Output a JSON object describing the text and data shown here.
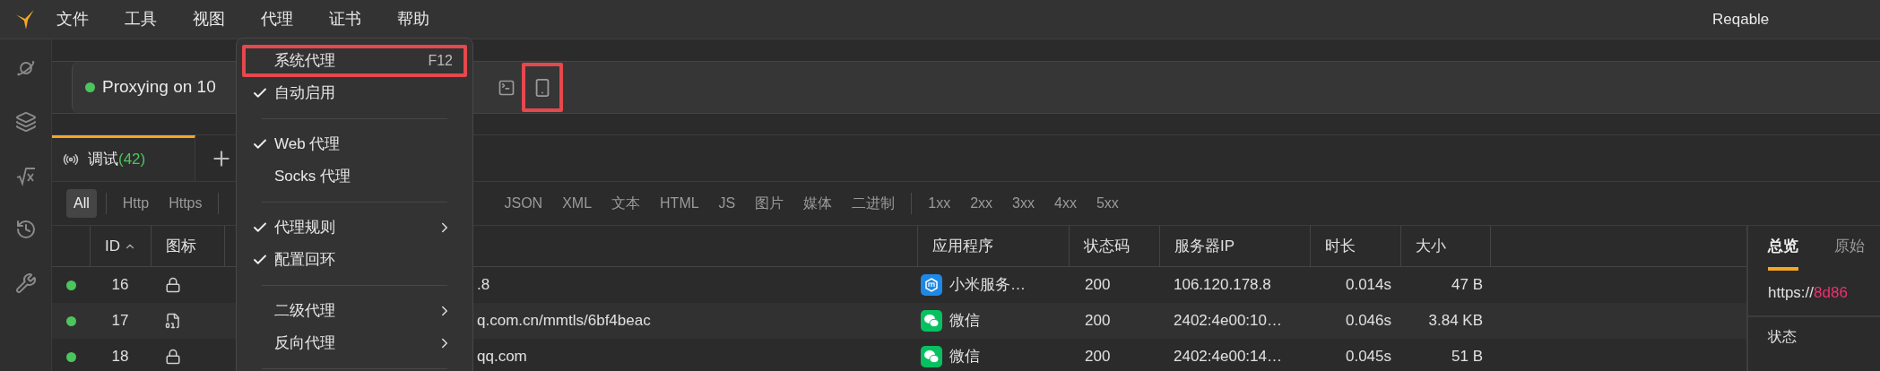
{
  "app": {
    "name": "Reqable"
  },
  "menubar": [
    "文件",
    "工具",
    "视图",
    "代理",
    "证书",
    "帮助"
  ],
  "proxy_bar": {
    "running": true,
    "status": "Proxying on 10",
    "actions": [
      {
        "kind": "terminal",
        "annotated": false
      },
      {
        "kind": "phone",
        "annotated": true
      }
    ]
  },
  "tabs": [
    {
      "label": "调试",
      "count": "(42)",
      "selected": true
    }
  ],
  "filters": [
    [
      {
        "label": "All",
        "selected": true
      }
    ],
    [
      {
        "label": "Http",
        "selected": false
      },
      {
        "label": "Https",
        "selected": false
      }
    ],
    [
      {
        "label": "JSON",
        "selected": false
      },
      {
        "label": "XML",
        "selected": false
      },
      {
        "label": "文本",
        "selected": false
      },
      {
        "label": "HTML",
        "selected": false
      },
      {
        "label": "JS",
        "selected": false
      },
      {
        "label": "图片",
        "selected": false
      },
      {
        "label": "媒体",
        "selected": false
      },
      {
        "label": "二进制",
        "selected": false
      }
    ],
    [
      {
        "label": "1xx",
        "selected": false
      },
      {
        "label": "2xx",
        "selected": false
      },
      {
        "label": "3xx",
        "selected": false
      },
      {
        "label": "4xx",
        "selected": false
      },
      {
        "label": "5xx",
        "selected": false
      }
    ]
  ],
  "table": {
    "columns": [
      {
        "label": "ID",
        "sorted": true
      },
      {
        "label": "图标",
        "sorted": false
      },
      {
        "label": "应用程序",
        "sorted": false
      },
      {
        "label": "状态码",
        "sorted": false
      },
      {
        "label": "服务器IP",
        "sorted": false
      },
      {
        "label": "时长",
        "sorted": false
      },
      {
        "label": "大小",
        "sorted": false
      }
    ],
    "rows": [
      {
        "id": "16",
        "icon": {
          "kind": "lock"
        },
        "url": ".8",
        "app": {
          "kind": "mi",
          "name": "小米服务…"
        },
        "status": "200",
        "ip": "106.120.178.8",
        "duration": "0.014s",
        "size": "47 B"
      },
      {
        "id": "17",
        "icon": {
          "kind": "binary"
        },
        "url": "q.com.cn/mmtls/6bf4beac",
        "app": {
          "kind": "wechat",
          "name": "微信"
        },
        "status": "200",
        "ip": "2402:4e00:10…",
        "duration": "0.046s",
        "size": "3.84 KB"
      },
      {
        "id": "18",
        "icon": {
          "kind": "lock"
        },
        "url": "qq.com",
        "app": {
          "kind": "wechat",
          "name": "微信"
        },
        "status": "200",
        "ip": "2402:4e00:14…",
        "duration": "0.045s",
        "size": "51 B"
      }
    ]
  },
  "detail": {
    "tabs": [
      {
        "label": "总览",
        "selected": true
      },
      {
        "label": "原始",
        "selected": false
      }
    ],
    "url_scheme": "https://",
    "url_host": "8d86",
    "fields": [
      "状态"
    ]
  },
  "menu": {
    "groups": [
      [
        {
          "label": "系统代理",
          "shortcut": "F12",
          "checked": false,
          "submenu": false,
          "annotated": true
        },
        {
          "label": "自动启用",
          "checked": true,
          "submenu": false,
          "annotated": false
        }
      ],
      [
        {
          "label": "Web 代理",
          "checked": true,
          "submenu": false,
          "annotated": false
        },
        {
          "label": "Socks 代理",
          "checked": false,
          "submenu": false,
          "annotated": false
        }
      ],
      [
        {
          "label": "代理规则",
          "checked": true,
          "submenu": true,
          "annotated": false
        },
        {
          "label": "配置回环",
          "checked": true,
          "submenu": false,
          "annotated": false
        }
      ],
      [
        {
          "label": "二级代理",
          "checked": false,
          "submenu": true,
          "annotated": false
        },
        {
          "label": "反向代理",
          "checked": false,
          "submenu": true,
          "annotated": false
        }
      ]
    ]
  }
}
